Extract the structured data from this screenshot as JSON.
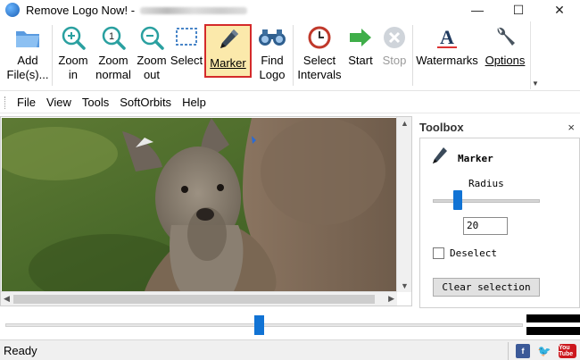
{
  "window": {
    "title": "Remove Logo Now! -",
    "controls": {
      "minimize": "—",
      "maximize": "☐",
      "close": "✕"
    }
  },
  "toolbar": {
    "buttons": [
      {
        "id": "add-files",
        "label": "Add\nFile(s)...",
        "icon": "folder-icon",
        "state": "normal"
      },
      {
        "id": "zoom-in",
        "label": "Zoom\nin",
        "icon": "zoom-in-icon",
        "state": "normal"
      },
      {
        "id": "zoom-normal",
        "label": "Zoom\nnormal",
        "icon": "zoom-normal-icon",
        "state": "normal"
      },
      {
        "id": "zoom-out",
        "label": "Zoom\nout",
        "icon": "zoom-out-icon",
        "state": "normal"
      },
      {
        "id": "select",
        "label": "Select",
        "icon": "select-icon",
        "state": "normal"
      },
      {
        "id": "marker",
        "label": "Marker",
        "icon": "marker-icon",
        "state": "active"
      },
      {
        "id": "find-logo",
        "label": "Find\nLogo",
        "icon": "binoculars-icon",
        "state": "normal"
      },
      {
        "id": "select-intervals",
        "label": "Select\nIntervals",
        "icon": "clock-icon",
        "state": "normal"
      },
      {
        "id": "start",
        "label": "Start",
        "icon": "start-arrow-icon",
        "state": "normal"
      },
      {
        "id": "stop",
        "label": "Stop",
        "icon": "stop-icon",
        "state": "disabled"
      },
      {
        "id": "watermarks",
        "label": "Watermarks",
        "icon": "watermark-icon",
        "state": "normal"
      },
      {
        "id": "options",
        "label": "Options",
        "icon": "wrench-icon",
        "state": "normal"
      }
    ]
  },
  "menu": {
    "items": [
      "File",
      "View",
      "Tools",
      "SoftOrbits",
      "Help"
    ]
  },
  "toolbox": {
    "title": "Toolbox",
    "close": "×",
    "tool_name": "Marker",
    "radius_label": "Radius",
    "radius_value": "20",
    "radius_slider_fraction": 0.23,
    "deselect_label": "Deselect",
    "deselect_checked": false,
    "clear_button": "Clear selection"
  },
  "timeline": {
    "position_fraction": 0.49
  },
  "status": {
    "text": "Ready"
  },
  "social": {
    "facebook": "f",
    "twitter": "🐦",
    "youtube": "You Tube"
  },
  "colors": {
    "accent": "#1173d4",
    "active_border": "#d42a2a",
    "active_fill": "#fbe9ab"
  }
}
